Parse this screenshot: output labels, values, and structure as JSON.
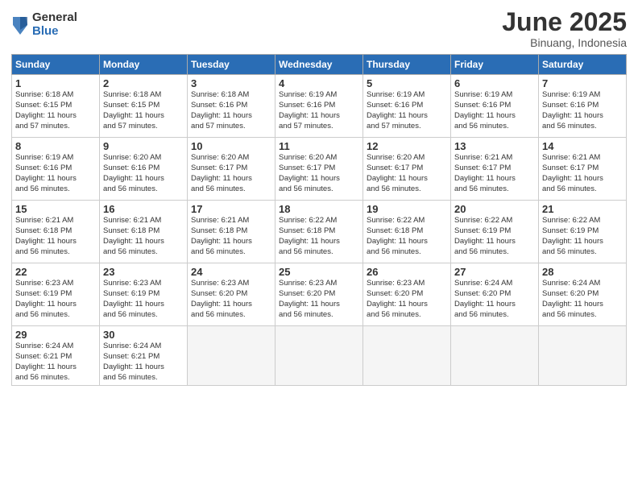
{
  "logo": {
    "general": "General",
    "blue": "Blue"
  },
  "title": "June 2025",
  "subtitle": "Binuang, Indonesia",
  "headers": [
    "Sunday",
    "Monday",
    "Tuesday",
    "Wednesday",
    "Thursday",
    "Friday",
    "Saturday"
  ],
  "weeks": [
    [
      {
        "day": "1",
        "detail": "Sunrise: 6:18 AM\nSunset: 6:15 PM\nDaylight: 11 hours\nand 57 minutes."
      },
      {
        "day": "2",
        "detail": "Sunrise: 6:18 AM\nSunset: 6:15 PM\nDaylight: 11 hours\nand 57 minutes."
      },
      {
        "day": "3",
        "detail": "Sunrise: 6:18 AM\nSunset: 6:16 PM\nDaylight: 11 hours\nand 57 minutes."
      },
      {
        "day": "4",
        "detail": "Sunrise: 6:19 AM\nSunset: 6:16 PM\nDaylight: 11 hours\nand 57 minutes."
      },
      {
        "day": "5",
        "detail": "Sunrise: 6:19 AM\nSunset: 6:16 PM\nDaylight: 11 hours\nand 57 minutes."
      },
      {
        "day": "6",
        "detail": "Sunrise: 6:19 AM\nSunset: 6:16 PM\nDaylight: 11 hours\nand 56 minutes."
      },
      {
        "day": "7",
        "detail": "Sunrise: 6:19 AM\nSunset: 6:16 PM\nDaylight: 11 hours\nand 56 minutes."
      }
    ],
    [
      {
        "day": "8",
        "detail": "Sunrise: 6:19 AM\nSunset: 6:16 PM\nDaylight: 11 hours\nand 56 minutes."
      },
      {
        "day": "9",
        "detail": "Sunrise: 6:20 AM\nSunset: 6:16 PM\nDaylight: 11 hours\nand 56 minutes."
      },
      {
        "day": "10",
        "detail": "Sunrise: 6:20 AM\nSunset: 6:17 PM\nDaylight: 11 hours\nand 56 minutes."
      },
      {
        "day": "11",
        "detail": "Sunrise: 6:20 AM\nSunset: 6:17 PM\nDaylight: 11 hours\nand 56 minutes."
      },
      {
        "day": "12",
        "detail": "Sunrise: 6:20 AM\nSunset: 6:17 PM\nDaylight: 11 hours\nand 56 minutes."
      },
      {
        "day": "13",
        "detail": "Sunrise: 6:21 AM\nSunset: 6:17 PM\nDaylight: 11 hours\nand 56 minutes."
      },
      {
        "day": "14",
        "detail": "Sunrise: 6:21 AM\nSunset: 6:17 PM\nDaylight: 11 hours\nand 56 minutes."
      }
    ],
    [
      {
        "day": "15",
        "detail": "Sunrise: 6:21 AM\nSunset: 6:18 PM\nDaylight: 11 hours\nand 56 minutes."
      },
      {
        "day": "16",
        "detail": "Sunrise: 6:21 AM\nSunset: 6:18 PM\nDaylight: 11 hours\nand 56 minutes."
      },
      {
        "day": "17",
        "detail": "Sunrise: 6:21 AM\nSunset: 6:18 PM\nDaylight: 11 hours\nand 56 minutes."
      },
      {
        "day": "18",
        "detail": "Sunrise: 6:22 AM\nSunset: 6:18 PM\nDaylight: 11 hours\nand 56 minutes."
      },
      {
        "day": "19",
        "detail": "Sunrise: 6:22 AM\nSunset: 6:18 PM\nDaylight: 11 hours\nand 56 minutes."
      },
      {
        "day": "20",
        "detail": "Sunrise: 6:22 AM\nSunset: 6:19 PM\nDaylight: 11 hours\nand 56 minutes."
      },
      {
        "day": "21",
        "detail": "Sunrise: 6:22 AM\nSunset: 6:19 PM\nDaylight: 11 hours\nand 56 minutes."
      }
    ],
    [
      {
        "day": "22",
        "detail": "Sunrise: 6:23 AM\nSunset: 6:19 PM\nDaylight: 11 hours\nand 56 minutes."
      },
      {
        "day": "23",
        "detail": "Sunrise: 6:23 AM\nSunset: 6:19 PM\nDaylight: 11 hours\nand 56 minutes."
      },
      {
        "day": "24",
        "detail": "Sunrise: 6:23 AM\nSunset: 6:20 PM\nDaylight: 11 hours\nand 56 minutes."
      },
      {
        "day": "25",
        "detail": "Sunrise: 6:23 AM\nSunset: 6:20 PM\nDaylight: 11 hours\nand 56 minutes."
      },
      {
        "day": "26",
        "detail": "Sunrise: 6:23 AM\nSunset: 6:20 PM\nDaylight: 11 hours\nand 56 minutes."
      },
      {
        "day": "27",
        "detail": "Sunrise: 6:24 AM\nSunset: 6:20 PM\nDaylight: 11 hours\nand 56 minutes."
      },
      {
        "day": "28",
        "detail": "Sunrise: 6:24 AM\nSunset: 6:20 PM\nDaylight: 11 hours\nand 56 minutes."
      }
    ],
    [
      {
        "day": "29",
        "detail": "Sunrise: 6:24 AM\nSunset: 6:21 PM\nDaylight: 11 hours\nand 56 minutes."
      },
      {
        "day": "30",
        "detail": "Sunrise: 6:24 AM\nSunset: 6:21 PM\nDaylight: 11 hours\nand 56 minutes."
      },
      null,
      null,
      null,
      null,
      null
    ]
  ]
}
